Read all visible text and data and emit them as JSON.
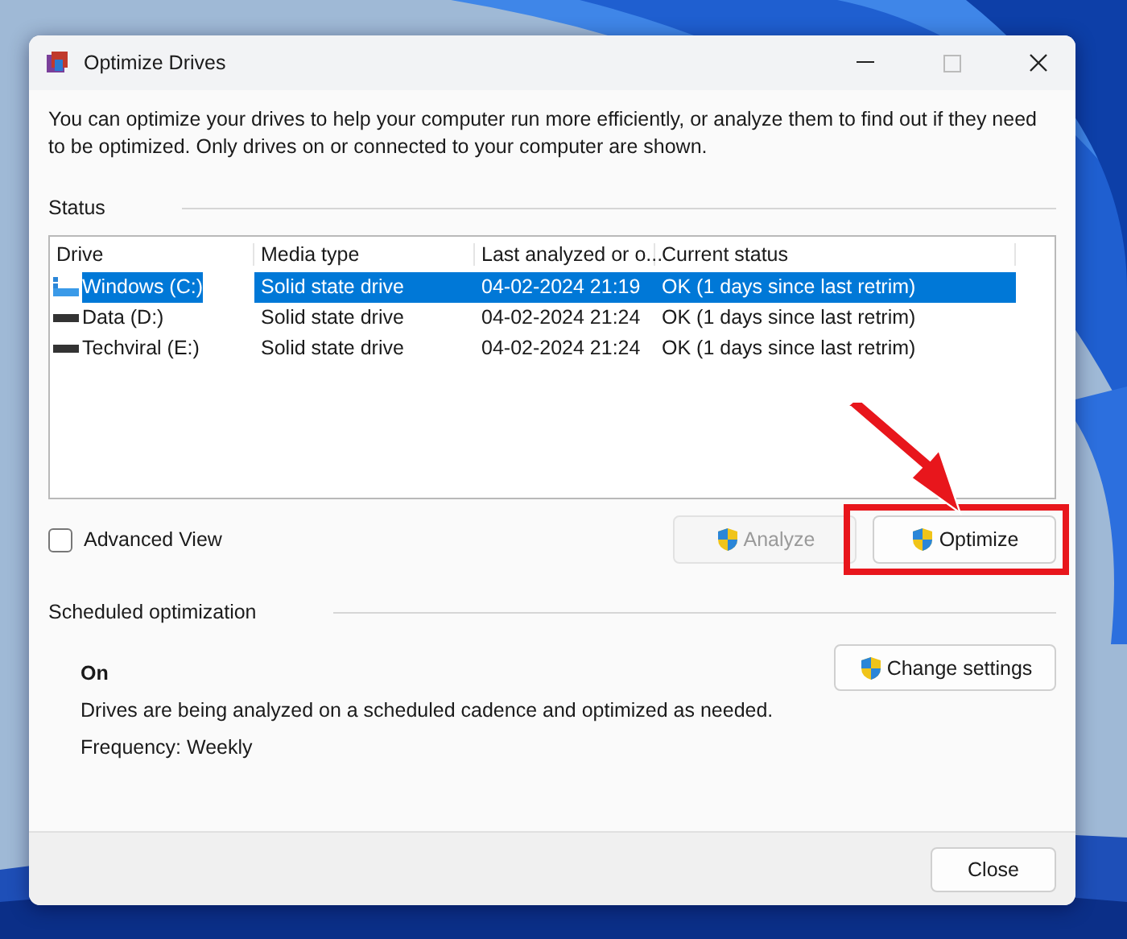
{
  "window": {
    "title": "Optimize Drives"
  },
  "description": "You can optimize your drives to help your computer run more efficiently, or analyze them to find out if they need to be optimized. Only drives on or connected to your computer are shown.",
  "status": {
    "heading": "Status",
    "columns": [
      "Drive",
      "Media type",
      "Last analyzed or o...",
      "Current status"
    ],
    "drives": [
      {
        "kind": "system",
        "name": "Windows (C:)",
        "media_type": "Solid state drive",
        "last_analyzed": "04-02-2024 21:19",
        "current_status": "OK (1 days since last retrim)",
        "selected": true
      },
      {
        "kind": "disk",
        "name": "Data (D:)",
        "media_type": "Solid state drive",
        "last_analyzed": "04-02-2024 21:24",
        "current_status": "OK (1 days since last retrim)",
        "selected": false
      },
      {
        "kind": "disk",
        "name": "Techviral (E:)",
        "media_type": "Solid state drive",
        "last_analyzed": "04-02-2024 21:24",
        "current_status": "OK (1 days since last retrim)",
        "selected": false
      }
    ]
  },
  "advanced_view": {
    "label": "Advanced View",
    "checked": false
  },
  "actions": [
    {
      "label": "Analyze",
      "disabled": true
    },
    {
      "label": "Optimize",
      "disabled": false
    }
  ],
  "scheduled": {
    "heading": "Scheduled optimization",
    "state": "On",
    "description": "Drives are being analyzed on a scheduled cadence and optimized as needed.",
    "frequency": "Frequency: Weekly",
    "button": "Change settings"
  },
  "footer": {
    "button": "Close"
  }
}
